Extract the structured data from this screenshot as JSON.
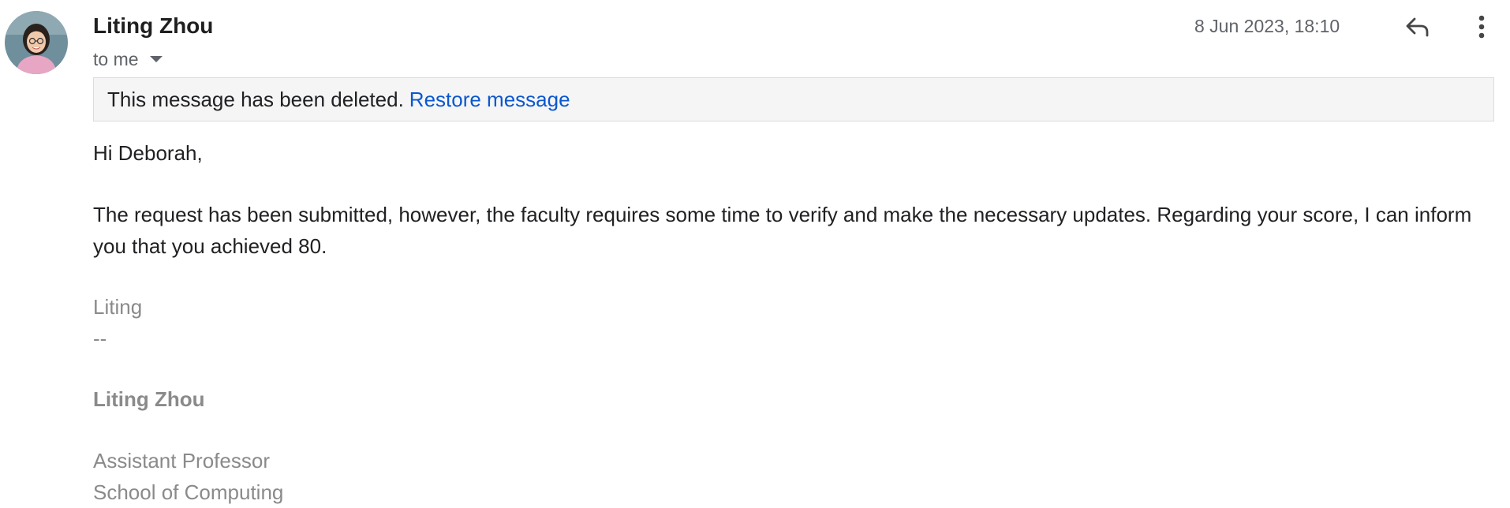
{
  "email": {
    "sender_name": "Liting Zhou",
    "recipient_label": "to me",
    "timestamp": "8 Jun 2023, 18:10",
    "avatar_icon": "person-photo-icon",
    "reply_icon": "reply-icon",
    "more_icon": "more-vert-icon"
  },
  "banner": {
    "message": "This message has been deleted.",
    "action_label": "Restore message",
    "link_color": "#0b57d0"
  },
  "body": {
    "greeting": "Hi Deborah,",
    "paragraph": "The request has been submitted, however, the faculty requires some time to verify and make the necessary updates. Regarding your score, I can inform you that you achieved 80."
  },
  "signature": {
    "first_name": "Liting",
    "separator": "--",
    "full_name": "Liting Zhou",
    "title": "Assistant Professor",
    "department": "School of Computing"
  }
}
